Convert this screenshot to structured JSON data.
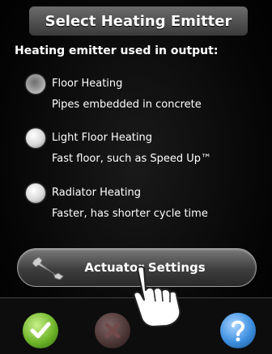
{
  "header": {
    "title": "Select Heating Emitter"
  },
  "prompt": "Heating emitter used in output:",
  "options": [
    {
      "label": "Floor Heating",
      "description": "Pipes embedded in concrete",
      "selected": true
    },
    {
      "label": "Light Floor Heating",
      "description": "Fast floor, such as Speed Up™",
      "selected": false
    },
    {
      "label": "Radiator Heating",
      "description": "Faster, has shorter cycle time",
      "selected": false
    }
  ],
  "actuator_button": {
    "label": "Actuator Settings",
    "icon": "wrench-icon"
  },
  "footer": {
    "ok_icon": "checkmark-icon",
    "cancel_icon": "x-icon",
    "help_icon": "question-mark-icon",
    "ok_color": "#6fb52a",
    "cancel_color": "#5b3e3e",
    "help_color": "#3d8fe0"
  }
}
